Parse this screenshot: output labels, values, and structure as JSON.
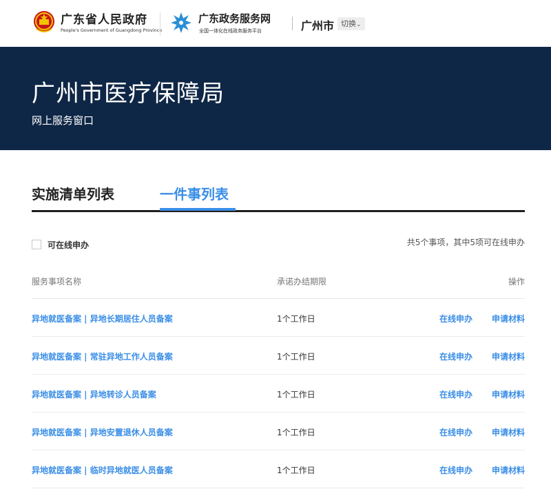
{
  "header": {
    "gov_title": "广东省人民政府",
    "gov_subtitle": "People's Government of Guangdong Province",
    "service_title": "广东政务服务网",
    "service_subtitle": "全国一体化在线政务服务平台",
    "city": "广州市",
    "switch_label": "切换",
    "switch_icon": "chevron-down-icon"
  },
  "banner": {
    "title": "广州市医疗保障局",
    "subtitle": "网上服务窗口"
  },
  "tabs": [
    {
      "label": "实施清单列表",
      "active": false
    },
    {
      "label": "一件事列表",
      "active": true
    }
  ],
  "filter": {
    "online_label": "可在线申办",
    "summary": "共5个事项，其中5项可在线申办"
  },
  "table": {
    "headers": {
      "name": "服务事项名称",
      "limit": "承诺办结期限",
      "op": "操作"
    },
    "rows": [
      {
        "name": "异地就医备案 | 异地长期居住人员备案",
        "limit": "1个工作日",
        "online": "在线申办",
        "material": "申请材料"
      },
      {
        "name": "异地就医备案 | 常驻异地工作人员备案",
        "limit": "1个工作日",
        "online": "在线申办",
        "material": "申请材料"
      },
      {
        "name": "异地就医备案 | 异地转诊人员备案",
        "limit": "1个工作日",
        "online": "在线申办",
        "material": "申请材料"
      },
      {
        "name": "异地就医备案 | 异地安置退休人员备案",
        "limit": "1个工作日",
        "online": "在线申办",
        "material": "申请材料"
      },
      {
        "name": "异地就医备案 | 临时异地就医人员备案",
        "limit": "1个工作日",
        "online": "在线申办",
        "material": "申请材料"
      }
    ]
  },
  "colors": {
    "banner_bg": "#0f2746",
    "accent": "#3a8ee6",
    "emblem_red": "#c8161d",
    "emblem_gold": "#f2c400"
  }
}
